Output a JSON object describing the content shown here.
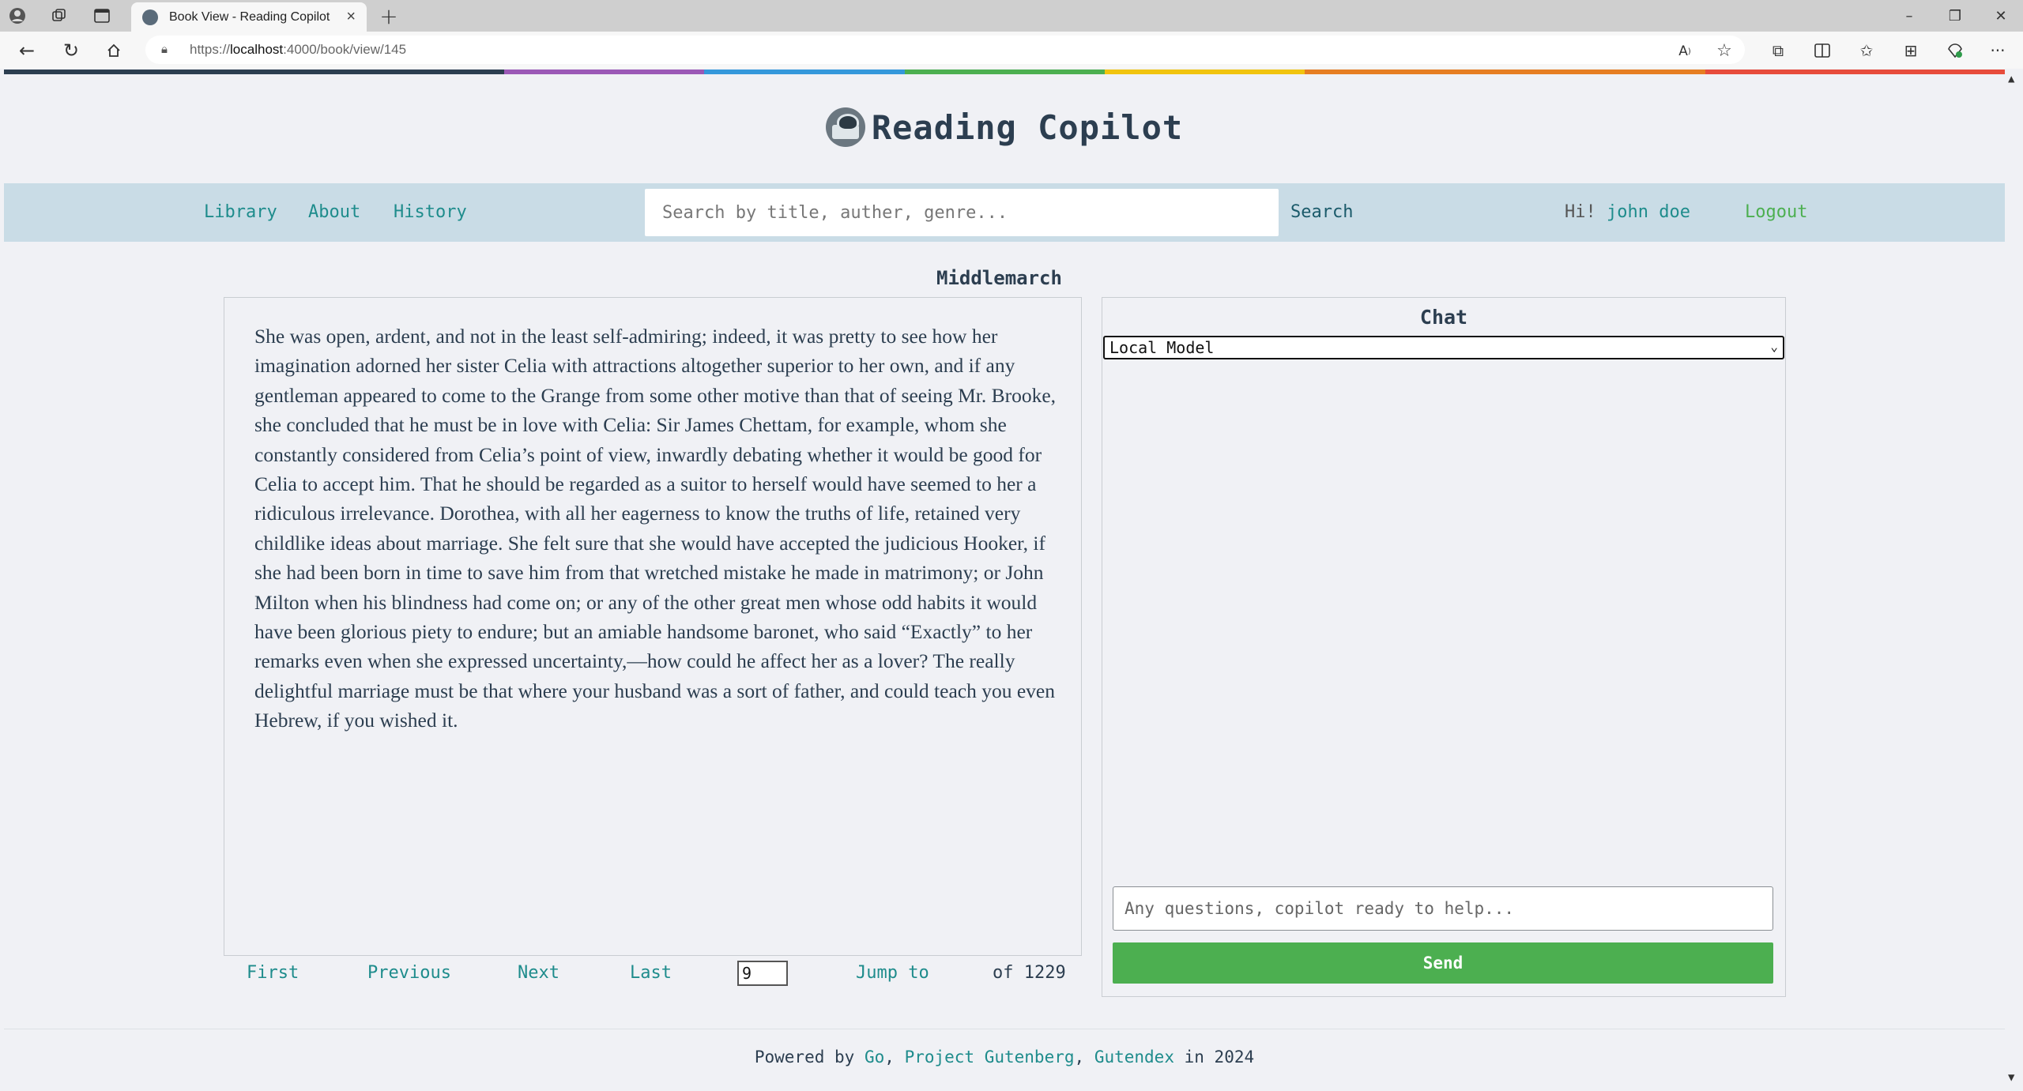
{
  "browser": {
    "tab_title": "Book View - Reading Copilot",
    "url_prefix": "https://",
    "url_host": "localhost",
    "url_rest": ":4000/book/view/145"
  },
  "site": {
    "title": "Reading Copilot"
  },
  "nav": {
    "library": "Library",
    "about": "About",
    "history": "History",
    "search_placeholder": "Search by title, auther, genre...",
    "search_button": "Search",
    "greeting": "Hi!",
    "username": "john doe",
    "logout": "Logout"
  },
  "book": {
    "title": "Middlemarch",
    "text": "She was open, ardent, and not in the least self-admiring; indeed, it was pretty to see how her imagination adorned her sister Celia with attractions altogether superior to her own, and if any gentleman appeared to come to the Grange from some other motive than that of seeing Mr. Brooke, she concluded that he must be in love with Celia: Sir James Chettam, for example, whom she constantly considered from Celia’s point of view, inwardly debating whether it would be good for Celia to accept him. That he should be regarded as a suitor to herself would have seemed to her a ridiculous irrelevance. Dorothea, with all her eagerness to know the truths of life, retained very childlike ideas about marriage. She felt sure that she would have accepted the judicious Hooker, if she had been born in time to save him from that wretched mistake he made in matrimony; or John Milton when his blindness had come on; or any of the other great men whose odd habits it would have been glorious piety to endure; but an amiable handsome baronet, who said “Exactly” to her remarks even when she expressed uncertainty,—how could he affect her as a lover? The really delightful marriage must be that where your husband was a sort of father, and could teach you even Hebrew, if you wished it."
  },
  "pager": {
    "first": "First",
    "previous": "Previous",
    "next": "Next",
    "last": "Last",
    "current_page": "9",
    "jump_to": "Jump to",
    "of_total": "of 1229"
  },
  "chat": {
    "title": "Chat",
    "model_selected": "Local Model",
    "input_placeholder": "Any questions, copilot ready to help...",
    "send": "Send"
  },
  "footer": {
    "powered_by": "Powered by",
    "go": "Go",
    "sep1": ",",
    "gutenberg": "Project Gutenberg",
    "sep2": ",",
    "gutendex": "Gutendex",
    "year_text": "in 2024"
  },
  "colors": {
    "accent_teal": "#1e8c8c",
    "send_green": "#4caf50",
    "nav_bg": "#c9dce6",
    "rainbow": [
      "#2c3e50",
      "#9b59b6",
      "#3498db",
      "#4caf50",
      "#f1c40f",
      "#e67e22",
      "#e74c3c"
    ]
  }
}
